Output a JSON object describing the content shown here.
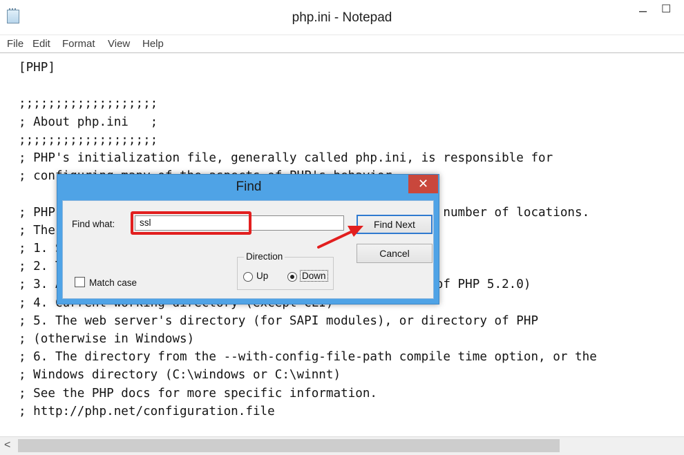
{
  "window": {
    "title": "php.ini - Notepad",
    "min_glyph": "–",
    "max_glyph": "☐"
  },
  "menu": {
    "items": [
      "File",
      "Edit",
      "Format",
      "View",
      "Help"
    ]
  },
  "editor": {
    "content": "[PHP]\n\n;;;;;;;;;;;;;;;;;;;\n; About php.ini   ;\n;;;;;;;;;;;;;;;;;;;\n; PHP's initialization file, generally called php.ini, is responsible for\n; configuring many of the aspects of PHP's behavior.\n\n; PHP attempts to find and load this configuration from a number of locations.\n; The following is a summary of its search order:\n; 1. SAPI module specific location.\n; 2. The PHPRC environment variable. (As of PHP 5.2.0)\n; 3. A number of predefined registry keys on Windows (As of PHP 5.2.0)\n; 4. Current working directory (except CLI)\n; 5. The web server's directory (for SAPI modules), or directory of PHP\n; (otherwise in Windows)\n; 6. The directory from the --with-config-file-path compile time option, or the\n; Windows directory (C:\\windows or C:\\winnt)\n; See the PHP docs for more specific information.\n; http://php.net/configuration.file"
  },
  "scrollbar": {
    "left_arrow": "<"
  },
  "find_dialog": {
    "title": "Find",
    "close_glyph": "✕",
    "find_what_label": "Find what:",
    "find_what_value": "ssl",
    "find_next_label": "Find Next",
    "cancel_label": "Cancel",
    "direction_label": "Direction",
    "up_label": "Up",
    "down_label": "Down",
    "direction_selected": "Down",
    "match_case_label": "Match case",
    "match_case_checked": false
  },
  "colors": {
    "dialog_frame": "#4fa3e6",
    "close_button": "#c9473c",
    "annotation_red": "#e21f1f",
    "default_button_border": "#2f7ad0"
  }
}
